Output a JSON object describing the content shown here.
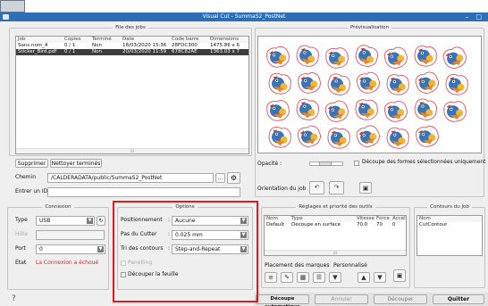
{
  "window": {
    "title": "Visual Cut - SummaS2_PostNet",
    "controls": "– □"
  },
  "files_panel": {
    "title": "File des jobs",
    "headers": [
      "Job",
      "Copies",
      "Terminé",
      "Date",
      "Code barre",
      "Dimensions"
    ],
    "rows": [
      [
        "Sans nom_4",
        "0 / 1",
        "Non",
        "18/03/2020 15:36",
        "28FDC300",
        "1475.86 x 6"
      ],
      [
        "Sticker_Bird.pdf",
        "0 / 1",
        "Non",
        "20/03/2020 11:59",
        "678C82AE",
        "1363.03 x 7"
      ]
    ],
    "scroll_marker": "III",
    "delete_button": "Supprimer",
    "clean_button": "Nettoyer terminés",
    "path_label": "Chemin",
    "path_value": "/CALDERADATA/public/SummaS2_PostNet",
    "browse_button": "...",
    "id_label": "Entrer un ID"
  },
  "preview_panel": {
    "title": "Prévisualisation",
    "opacity_label": "Opacité :",
    "cut_selected_label": "Découpe des formes sélectionnées uniquement !",
    "orientation_label": "Orientation du job"
  },
  "connection": {
    "title": "Connexion",
    "type_label": "Type",
    "type_value": "USB",
    "host_label": "Hôte",
    "port_label": "Port",
    "port_value": "0",
    "state_label": "État",
    "state_value": "La Connexion a échoué",
    "state_color": "#e11b22"
  },
  "options": {
    "title": "Options",
    "positioning_label": "Positionnement",
    "positioning_value": "Aucune",
    "step_label": "Pas du Cutter",
    "step_value": "0.025 mm",
    "sort_label": "Tri des contours",
    "sort_value": "Step-and-Repeat",
    "paneling_label": "Panelling",
    "cut_sheet_label": "Découper la feuille"
  },
  "tools": {
    "title": "Réglages et priorité des outils",
    "headers": [
      "Nom",
      "Type",
      "Vitesse",
      "Force",
      "Accél"
    ],
    "row": [
      "Default",
      "Découpe en surface",
      "70.0",
      "70",
      "0"
    ],
    "scroll_marker": "III",
    "marks_label": "Placement des marques",
    "marks_value": "Personnalisé"
  },
  "contours": {
    "title": "Contours du job",
    "header": "Nom",
    "item": "CutContour"
  },
  "footer": {
    "help": "?",
    "auto_cut": "Découpe automatique",
    "cancel": "Annuler",
    "cut": "Découper",
    "quit": "Quitter"
  },
  "colors": {
    "titlebar": "#2c6fb5",
    "highlight": "#e11b22",
    "selected_row": "#3d3d3d"
  }
}
